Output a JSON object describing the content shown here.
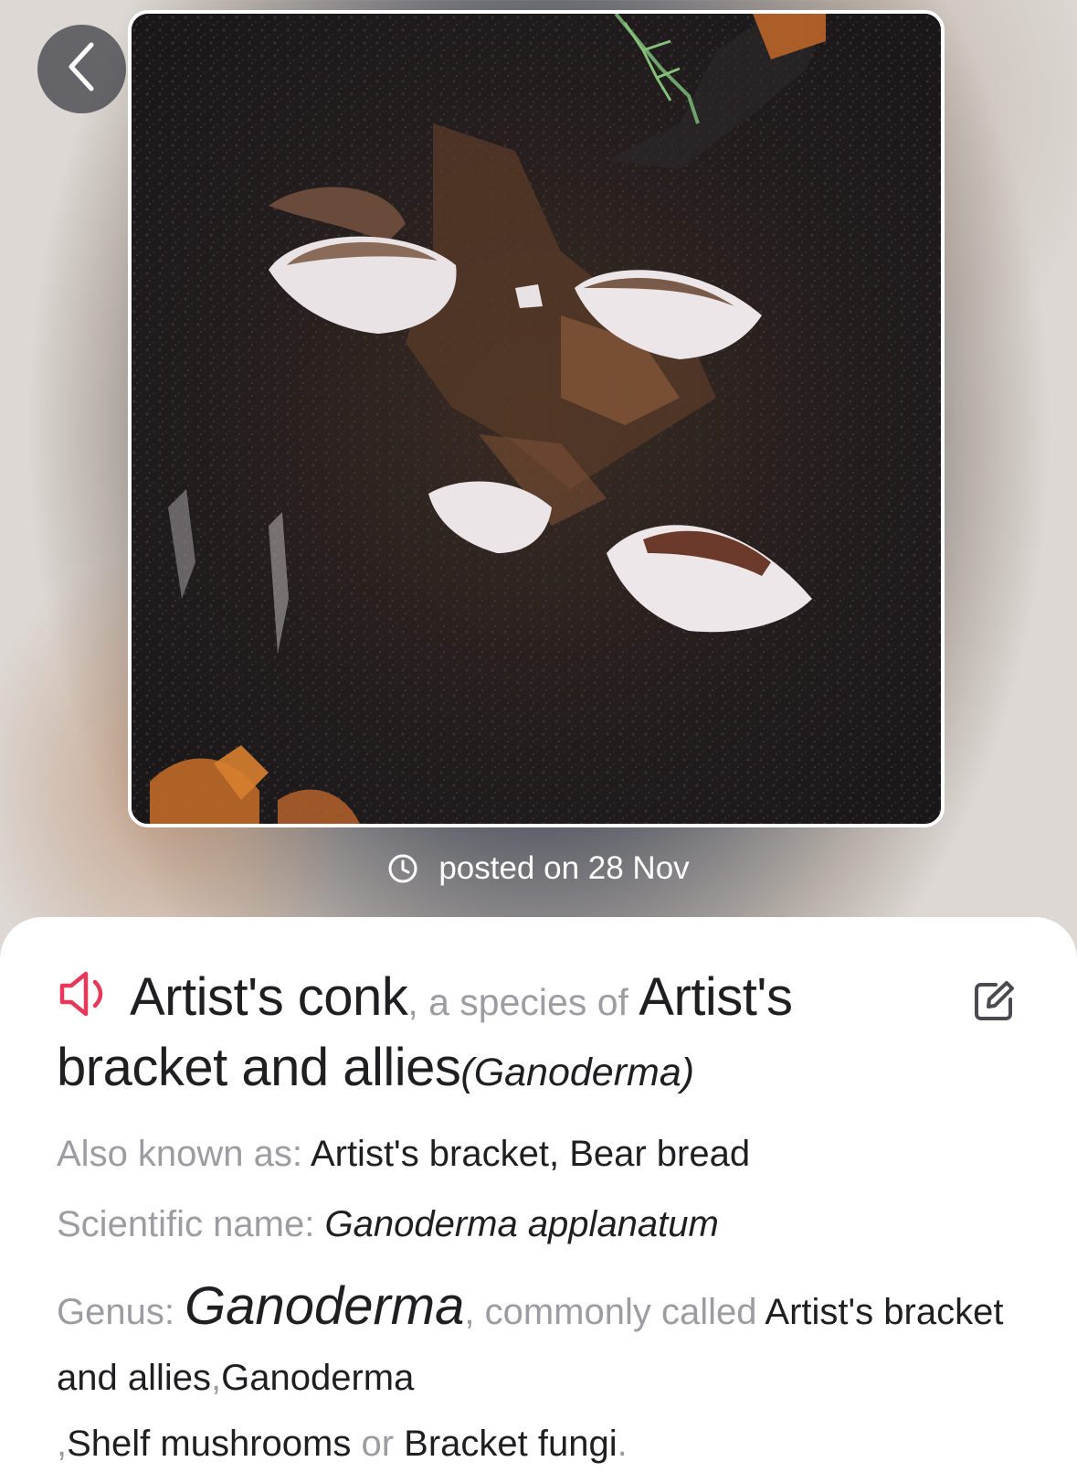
{
  "nav": {
    "back_icon": "chevron-left-icon"
  },
  "photo": {
    "alt": "Artist's conk"
  },
  "meta": {
    "posted_label": "posted on 28 Nov",
    "clock_icon": "clock-icon"
  },
  "species": {
    "speaker_icon": "speaker-icon",
    "common_name": "Artist's conk",
    "connector": ", a species of ",
    "group_name": "Artist's bracket and allies",
    "genus_paren": "(Ganoderma)",
    "edit_icon": "edit-icon"
  },
  "also_known_as": {
    "label": "Also known as: ",
    "value": "Artist's bracket, Bear bread"
  },
  "scientific_name": {
    "label": "Scientific name: ",
    "value": "Ganoderma applanatum"
  },
  "genus": {
    "label": "Genus: ",
    "name": "Ganoderma",
    "connector": ", commonly called ",
    "common_1": "Artist's bracket and allies",
    "sep_1": ",",
    "common_2": "Ganoderma",
    "sep_2": ",",
    "common_3": "Shelf mushrooms",
    "or_word": " or ",
    "common_4": "Bracket fungi",
    "end": "."
  },
  "colors": {
    "accent_speaker": "#e8385a",
    "muted_text": "#9c9ca2",
    "primary_text": "#1f1f22"
  }
}
